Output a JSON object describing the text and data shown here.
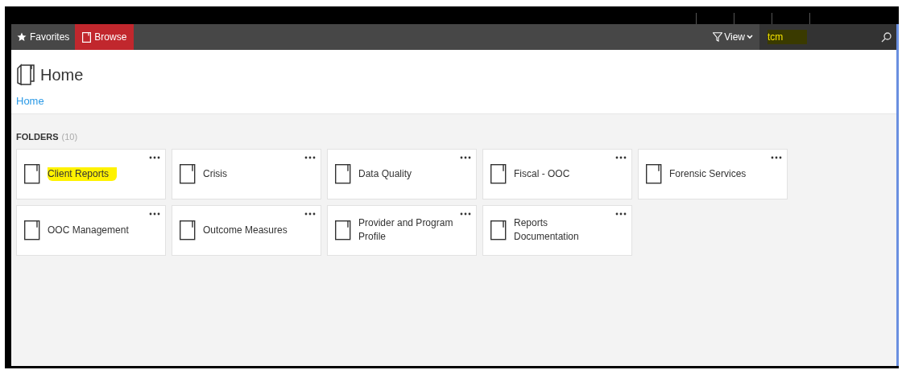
{
  "nav": {
    "tabs": [
      {
        "label": "Favorites",
        "selected": false
      },
      {
        "label": "Browse",
        "selected": true
      }
    ],
    "view_button": "View",
    "search": {
      "value": "tcm",
      "highlighted": true
    }
  },
  "header": {
    "title": "Home",
    "breadcrumb": "Home"
  },
  "folders": {
    "heading": "FOLDERS",
    "count": "(10)",
    "items": [
      {
        "name": "Client Reports",
        "highlighted": true
      },
      {
        "name": "Crisis",
        "highlighted": false
      },
      {
        "name": "Data Quality",
        "highlighted": false
      },
      {
        "name": "Fiscal - OOC",
        "highlighted": false
      },
      {
        "name": "Forensic Services",
        "highlighted": false
      },
      {
        "name": "OOC Management",
        "highlighted": false
      },
      {
        "name": "Outcome Measures",
        "highlighted": false
      },
      {
        "name": "Provider and Program Profile",
        "highlighted": false
      },
      {
        "name": "Reports Documentation",
        "highlighted": false
      }
    ]
  }
}
